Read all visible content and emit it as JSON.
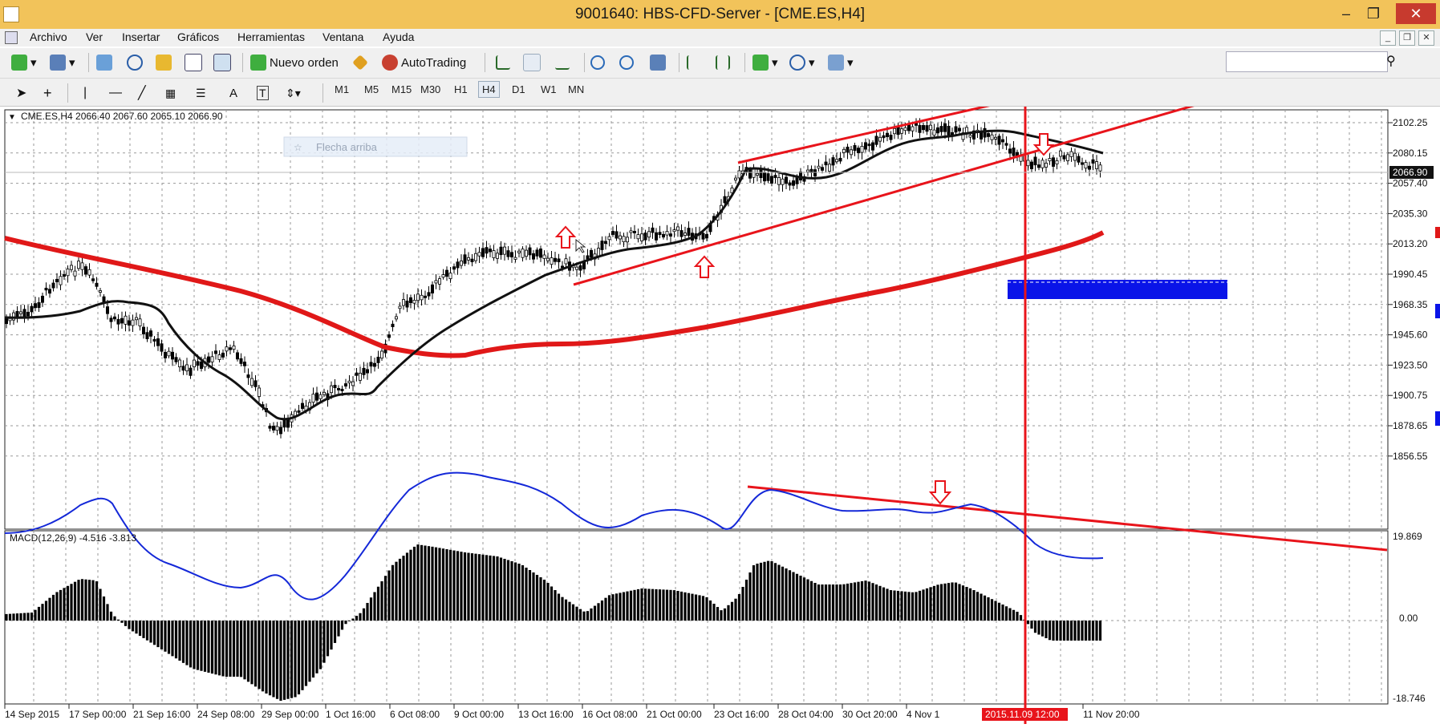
{
  "window": {
    "title": "9001640: HBS-CFD-Server - [CME.ES,H4]",
    "minimize": "–",
    "maximize": "❐",
    "close": "✕"
  },
  "menu": [
    "Archivo",
    "Ver",
    "Insertar",
    "Gráficos",
    "Herramientas",
    "Ventana",
    "Ayuda"
  ],
  "toolbar": {
    "new_order_label": "Nuevo orden",
    "autotrading_label": "AutoTrading"
  },
  "timeframes": [
    "M1",
    "M5",
    "M15",
    "M30",
    "H1",
    "H4",
    "D1",
    "W1",
    "MN"
  ],
  "active_timeframe": "H4",
  "chart": {
    "symbol_info": "CME.ES,H4  2066.40 2067.60 2065.10 2066.90",
    "object_label": "Flecha arriba",
    "current_price": "2066.90",
    "price_ticks": [
      "2102.25",
      "2080.15",
      "2057.40",
      "2035.30",
      "2013.20",
      "1990.45",
      "1968.35",
      "1945.60",
      "1923.50",
      "1900.75",
      "1878.65",
      "1856.55"
    ],
    "macd_label": "MACD(12,26,9) -4.516 -3.813",
    "macd_ticks": [
      "19.869",
      "0.00",
      "-18.746"
    ],
    "time_ticks": [
      "14 Sep 2015",
      "17 Sep 00:00",
      "21 Sep 16:00",
      "24 Sep 08:00",
      "29 Sep 00:00",
      "1 Oct 16:00",
      "6 Oct 08:00",
      "9 Oct 00:00",
      "13 Oct 16:00",
      "16 Oct 08:00",
      "21 Oct 00:00",
      "23 Oct 16:00",
      "28 Oct 04:00",
      "30 Oct 20:00",
      "4 Nov 1",
      "11 Nov 20:00"
    ],
    "crosshair_time": "2015.11.09 12:00",
    "colors": {
      "trendline": "#e8141b",
      "ma_slow": "#e01818",
      "ma_fast": "#111111",
      "macd_signal": "#1428d8",
      "zone": "#0a14e8"
    }
  }
}
